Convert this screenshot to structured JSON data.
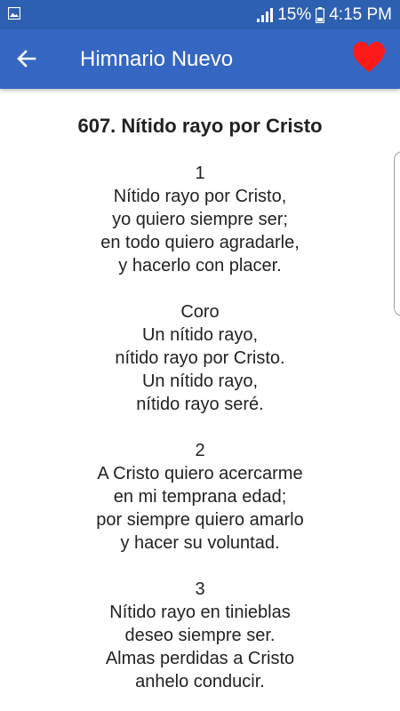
{
  "status_bar": {
    "battery_percent": "15%",
    "time": "4:15 PM",
    "icons": [
      "image-icon",
      "signal-icon",
      "battery-icon"
    ]
  },
  "app_bar": {
    "title": "Himnario Nuevo",
    "back_icon": "arrow-left-icon",
    "favorite_icon": "heart-icon",
    "favorite_color": "#ff1a1a",
    "background_color": "#3567c2"
  },
  "hymn": {
    "title": "607. Nítido rayo por Cristo",
    "stanzas": [
      {
        "heading": "1",
        "lines": [
          "Nítido rayo por Cristo,",
          "yo quiero siempre ser;",
          "en todo quiero agradarle,",
          "y hacerlo con placer."
        ]
      },
      {
        "heading": "Coro",
        "lines": [
          "Un nítido rayo,",
          "nítido rayo por Cristo.",
          "Un nítido rayo,",
          "nítido rayo seré."
        ]
      },
      {
        "heading": "2",
        "lines": [
          "A Cristo quiero acercarme",
          "en mi temprana edad;",
          "por siempre quiero amarlo",
          "y hacer su voluntad."
        ]
      },
      {
        "heading": "3",
        "lines": [
          "Nítido rayo en tinieblas",
          "deseo siempre ser.",
          "Almas perdidas a Cristo",
          "anhelo conducir."
        ]
      }
    ]
  }
}
